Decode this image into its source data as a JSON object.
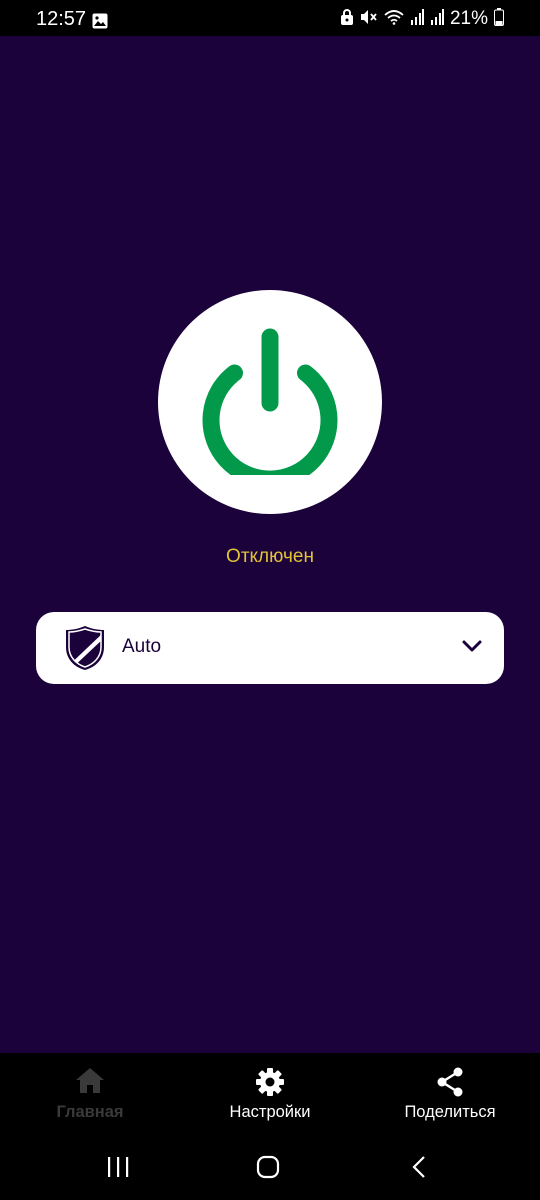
{
  "status_bar": {
    "time": "12:57",
    "battery_percent": "21%",
    "icons": [
      "image-icon",
      "lock-icon",
      "mute-icon",
      "wifi-icon",
      "signal-icon",
      "signal-icon",
      "battery-icon"
    ]
  },
  "connection": {
    "status_text": "Отключен",
    "power_icon": "power-icon",
    "power_color": "#029a4a",
    "status_color": "#e1c238"
  },
  "server_select": {
    "selected": "Auto",
    "icon": "shield-icon"
  },
  "bottom_nav": {
    "items": [
      {
        "label": "Главная",
        "icon": "home-icon",
        "active": true
      },
      {
        "label": "Настройки",
        "icon": "gear-icon",
        "active": false
      },
      {
        "label": "Поделиться",
        "icon": "share-icon",
        "active": false
      }
    ]
  },
  "colors": {
    "background": "#1b023b",
    "card": "#ffffff",
    "nav_background": "#000000"
  }
}
